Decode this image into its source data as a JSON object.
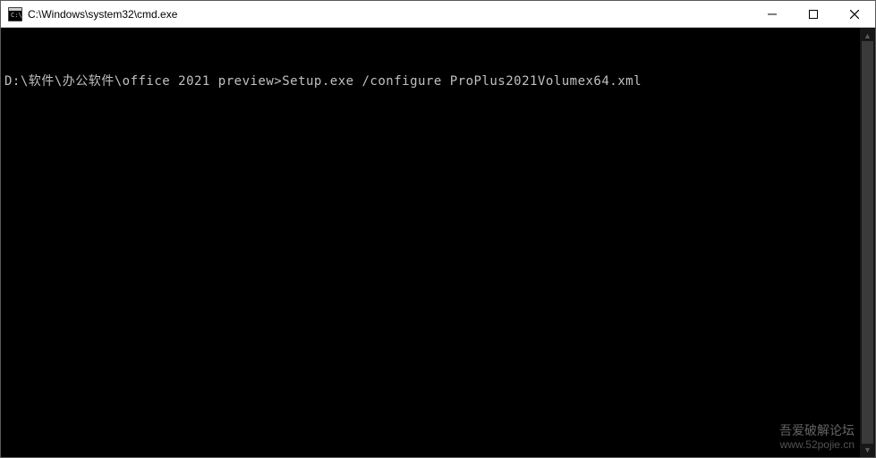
{
  "titlebar": {
    "title": "C:\\Windows\\system32\\cmd.exe",
    "minimize_label": "Minimize",
    "maximize_label": "Maximize",
    "close_label": "Close"
  },
  "console": {
    "prompt": "D:\\软件\\办公软件\\office 2021 preview>Setup.exe /configure ProPlus2021Volumex64.xml"
  },
  "watermark": {
    "line1": "吾爱破解论坛",
    "line2": "www.52pojie.cn"
  }
}
